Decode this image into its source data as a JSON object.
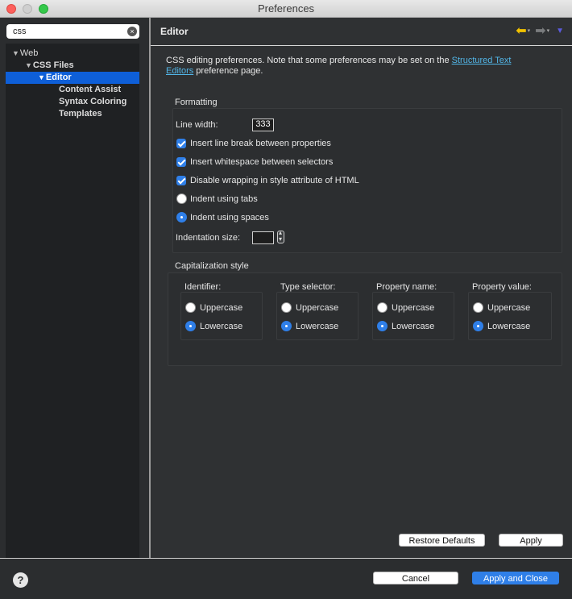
{
  "window": {
    "title": "Preferences"
  },
  "sidebar": {
    "search_value": "css",
    "tree": [
      {
        "label": "Web",
        "level": 0,
        "expanded": true,
        "selected": false
      },
      {
        "label": "CSS Files",
        "level": 1,
        "expanded": true,
        "selected": false
      },
      {
        "label": "Editor",
        "level": 2,
        "expanded": true,
        "selected": true
      },
      {
        "label": "Content Assist",
        "level": 3,
        "selected": false
      },
      {
        "label": "Syntax Coloring",
        "level": 3,
        "selected": false
      },
      {
        "label": "Templates",
        "level": 3,
        "selected": false
      }
    ]
  },
  "page": {
    "title": "Editor",
    "intro_text": "CSS editing preferences.  Note that some preferences may be set on the ",
    "intro_link": "Structured Text Editors",
    "intro_link_line1": "Structured Text",
    "intro_link_line2": "Editors",
    "intro_suffix": " preference page."
  },
  "formatting": {
    "title": "Formatting",
    "line_width_label": "Line width:",
    "line_width_value": "333",
    "options": [
      {
        "label": "Insert line break between properties",
        "checked": true
      },
      {
        "label": "Insert whitespace between selectors",
        "checked": true
      },
      {
        "label": "Disable wrapping in style attribute of HTML",
        "checked": true
      }
    ],
    "indent_tabs_label": "Indent using tabs",
    "indent_spaces_label": "Indent using spaces",
    "indent_mode": "spaces",
    "indentation_size_label": "Indentation size:",
    "indentation_size_value": ""
  },
  "capitalization": {
    "title": "Capitalization style",
    "columns": [
      {
        "label": "Identifier:",
        "uppercase": "Uppercase",
        "lowercase": "Lowercase",
        "selected": "lowercase"
      },
      {
        "label": "Type selector:",
        "uppercase": "Uppercase",
        "lowercase": "Lowercase",
        "selected": "lowercase"
      },
      {
        "label": "Property name:",
        "uppercase": "Uppercase",
        "lowercase": "Lowercase",
        "selected": "lowercase"
      },
      {
        "label": "Property value:",
        "uppercase": "Uppercase",
        "lowercase": "Lowercase",
        "selected": "lowercase"
      }
    ]
  },
  "buttons": {
    "restore_defaults": "Restore Defaults",
    "apply": "Apply",
    "cancel": "Cancel",
    "apply_and_close": "Apply and Close"
  },
  "icons": {
    "back": "back-arrow-icon",
    "forward": "forward-arrow-icon",
    "menu": "view-menu-icon",
    "help": "help-icon",
    "clear": "clear-search-icon"
  },
  "colors": {
    "accent": "#2f7fe8",
    "selection": "#0e5fd8",
    "link": "#52b6e8",
    "back_arrow": "#f2c200",
    "menu_arrow": "#5b5bdc"
  }
}
